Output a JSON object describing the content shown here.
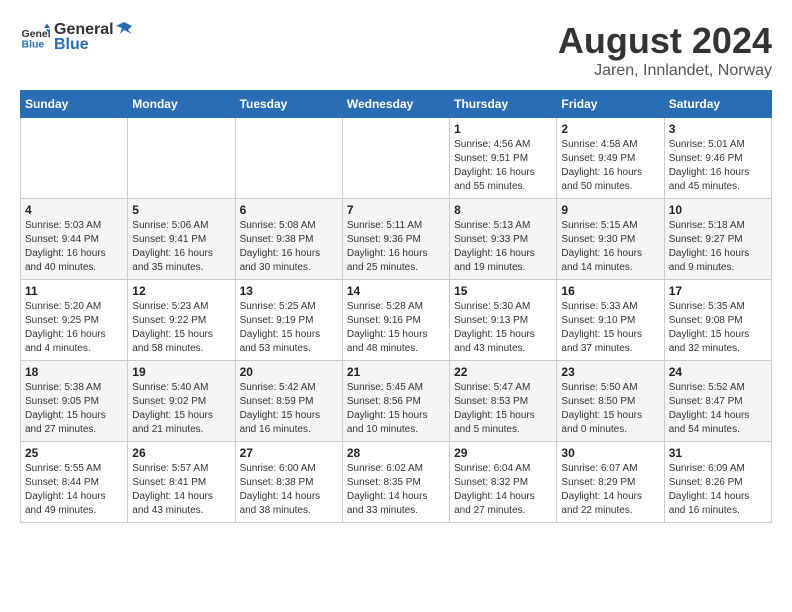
{
  "header": {
    "logo_general": "General",
    "logo_blue": "Blue",
    "month_title": "August 2024",
    "location": "Jaren, Innlandet, Norway"
  },
  "weekdays": [
    "Sunday",
    "Monday",
    "Tuesday",
    "Wednesday",
    "Thursday",
    "Friday",
    "Saturday"
  ],
  "weeks": [
    [
      {
        "day": "",
        "info": ""
      },
      {
        "day": "",
        "info": ""
      },
      {
        "day": "",
        "info": ""
      },
      {
        "day": "",
        "info": ""
      },
      {
        "day": "1",
        "info": "Sunrise: 4:56 AM\nSunset: 9:51 PM\nDaylight: 16 hours\nand 55 minutes."
      },
      {
        "day": "2",
        "info": "Sunrise: 4:58 AM\nSunset: 9:49 PM\nDaylight: 16 hours\nand 50 minutes."
      },
      {
        "day": "3",
        "info": "Sunrise: 5:01 AM\nSunset: 9:46 PM\nDaylight: 16 hours\nand 45 minutes."
      }
    ],
    [
      {
        "day": "4",
        "info": "Sunrise: 5:03 AM\nSunset: 9:44 PM\nDaylight: 16 hours\nand 40 minutes."
      },
      {
        "day": "5",
        "info": "Sunrise: 5:06 AM\nSunset: 9:41 PM\nDaylight: 16 hours\nand 35 minutes."
      },
      {
        "day": "6",
        "info": "Sunrise: 5:08 AM\nSunset: 9:38 PM\nDaylight: 16 hours\nand 30 minutes."
      },
      {
        "day": "7",
        "info": "Sunrise: 5:11 AM\nSunset: 9:36 PM\nDaylight: 16 hours\nand 25 minutes."
      },
      {
        "day": "8",
        "info": "Sunrise: 5:13 AM\nSunset: 9:33 PM\nDaylight: 16 hours\nand 19 minutes."
      },
      {
        "day": "9",
        "info": "Sunrise: 5:15 AM\nSunset: 9:30 PM\nDaylight: 16 hours\nand 14 minutes."
      },
      {
        "day": "10",
        "info": "Sunrise: 5:18 AM\nSunset: 9:27 PM\nDaylight: 16 hours\nand 9 minutes."
      }
    ],
    [
      {
        "day": "11",
        "info": "Sunrise: 5:20 AM\nSunset: 9:25 PM\nDaylight: 16 hours\nand 4 minutes."
      },
      {
        "day": "12",
        "info": "Sunrise: 5:23 AM\nSunset: 9:22 PM\nDaylight: 15 hours\nand 58 minutes."
      },
      {
        "day": "13",
        "info": "Sunrise: 5:25 AM\nSunset: 9:19 PM\nDaylight: 15 hours\nand 53 minutes."
      },
      {
        "day": "14",
        "info": "Sunrise: 5:28 AM\nSunset: 9:16 PM\nDaylight: 15 hours\nand 48 minutes."
      },
      {
        "day": "15",
        "info": "Sunrise: 5:30 AM\nSunset: 9:13 PM\nDaylight: 15 hours\nand 43 minutes."
      },
      {
        "day": "16",
        "info": "Sunrise: 5:33 AM\nSunset: 9:10 PM\nDaylight: 15 hours\nand 37 minutes."
      },
      {
        "day": "17",
        "info": "Sunrise: 5:35 AM\nSunset: 9:08 PM\nDaylight: 15 hours\nand 32 minutes."
      }
    ],
    [
      {
        "day": "18",
        "info": "Sunrise: 5:38 AM\nSunset: 9:05 PM\nDaylight: 15 hours\nand 27 minutes."
      },
      {
        "day": "19",
        "info": "Sunrise: 5:40 AM\nSunset: 9:02 PM\nDaylight: 15 hours\nand 21 minutes."
      },
      {
        "day": "20",
        "info": "Sunrise: 5:42 AM\nSunset: 8:59 PM\nDaylight: 15 hours\nand 16 minutes."
      },
      {
        "day": "21",
        "info": "Sunrise: 5:45 AM\nSunset: 8:56 PM\nDaylight: 15 hours\nand 10 minutes."
      },
      {
        "day": "22",
        "info": "Sunrise: 5:47 AM\nSunset: 8:53 PM\nDaylight: 15 hours\nand 5 minutes."
      },
      {
        "day": "23",
        "info": "Sunrise: 5:50 AM\nSunset: 8:50 PM\nDaylight: 15 hours\nand 0 minutes."
      },
      {
        "day": "24",
        "info": "Sunrise: 5:52 AM\nSunset: 8:47 PM\nDaylight: 14 hours\nand 54 minutes."
      }
    ],
    [
      {
        "day": "25",
        "info": "Sunrise: 5:55 AM\nSunset: 8:44 PM\nDaylight: 14 hours\nand 49 minutes."
      },
      {
        "day": "26",
        "info": "Sunrise: 5:57 AM\nSunset: 8:41 PM\nDaylight: 14 hours\nand 43 minutes."
      },
      {
        "day": "27",
        "info": "Sunrise: 6:00 AM\nSunset: 8:38 PM\nDaylight: 14 hours\nand 38 minutes."
      },
      {
        "day": "28",
        "info": "Sunrise: 6:02 AM\nSunset: 8:35 PM\nDaylight: 14 hours\nand 33 minutes."
      },
      {
        "day": "29",
        "info": "Sunrise: 6:04 AM\nSunset: 8:32 PM\nDaylight: 14 hours\nand 27 minutes."
      },
      {
        "day": "30",
        "info": "Sunrise: 6:07 AM\nSunset: 8:29 PM\nDaylight: 14 hours\nand 22 minutes."
      },
      {
        "day": "31",
        "info": "Sunrise: 6:09 AM\nSunset: 8:26 PM\nDaylight: 14 hours\nand 16 minutes."
      }
    ]
  ]
}
